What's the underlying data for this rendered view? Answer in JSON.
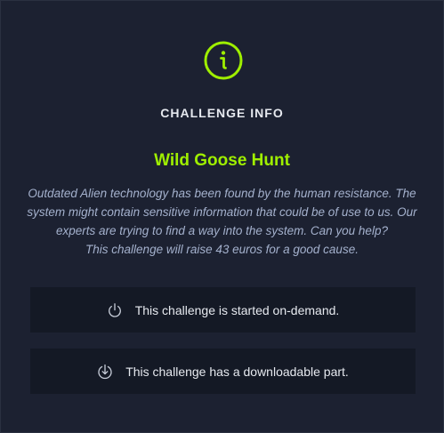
{
  "modal": {
    "heading": "CHALLENGE INFO",
    "challenge_name": "Wild Goose Hunt",
    "description_lines": [
      "Outdated Alien technology has been found by the human resistance. The",
      "system might contain sensitive information that could be of use to us. Our",
      "experts are trying to find a way into the system. Can you help?",
      "This challenge will raise 43 euros for a good cause."
    ],
    "features": [
      {
        "icon": "power-icon",
        "label": "This challenge is started on-demand."
      },
      {
        "icon": "download-icon",
        "label": "This challenge has a downloadable part."
      }
    ]
  },
  "colors": {
    "accent": "#9fef00",
    "background": "#1c2131",
    "card_background": "#141925",
    "description_text": "#a4b1cd"
  }
}
